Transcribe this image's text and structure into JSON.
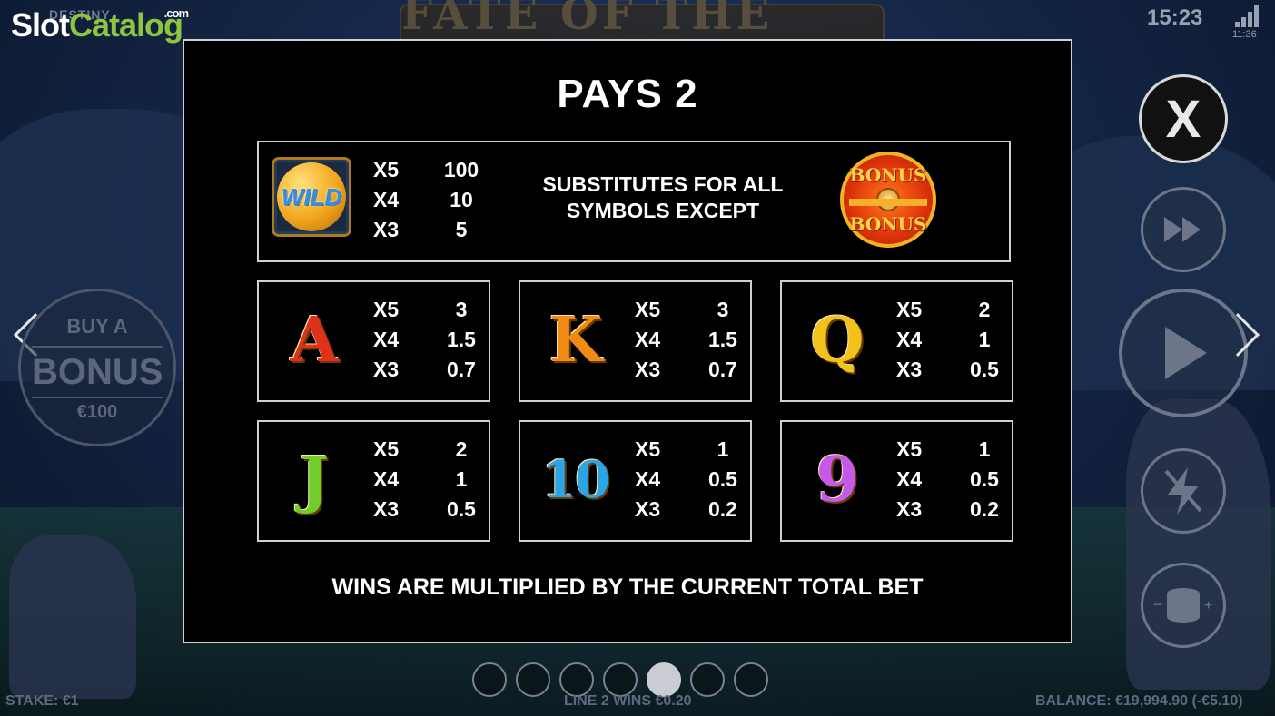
{
  "watermark": {
    "part1": "Slot",
    "part2": "Catalog",
    "suffix": ".com"
  },
  "brand_small": "DESTINY",
  "game_logo": "FATE OF THE GODS",
  "clock": {
    "time": "15:23",
    "small": "11:36"
  },
  "panel": {
    "title": "PAYS 2",
    "wild": {
      "icon_label": "WILD",
      "pays": [
        {
          "mult": "X5",
          "value": "100"
        },
        {
          "mult": "X4",
          "value": "10"
        },
        {
          "mult": "X3",
          "value": "5"
        }
      ],
      "substitute_text_line1": "SUBSTITUTES FOR ALL",
      "substitute_text_line2": "SYMBOLS EXCEPT",
      "bonus_label_top": "BONUS",
      "bonus_label_bottom": "BONUS"
    },
    "symbols": [
      {
        "glyph": "A",
        "color": "#e0321a",
        "pays": [
          {
            "mult": "X5",
            "value": "3"
          },
          {
            "mult": "X4",
            "value": "1.5"
          },
          {
            "mult": "X3",
            "value": "0.7"
          }
        ]
      },
      {
        "glyph": "K",
        "color": "#f08a12",
        "pays": [
          {
            "mult": "X5",
            "value": "3"
          },
          {
            "mult": "X4",
            "value": "1.5"
          },
          {
            "mult": "X3",
            "value": "0.7"
          }
        ]
      },
      {
        "glyph": "Q",
        "color": "#f2c21c",
        "pays": [
          {
            "mult": "X5",
            "value": "2"
          },
          {
            "mult": "X4",
            "value": "1"
          },
          {
            "mult": "X3",
            "value": "0.5"
          }
        ]
      },
      {
        "glyph": "J",
        "color": "#6fce2a",
        "pays": [
          {
            "mult": "X5",
            "value": "2"
          },
          {
            "mult": "X4",
            "value": "1"
          },
          {
            "mult": "X3",
            "value": "0.5"
          }
        ]
      },
      {
        "glyph": "10",
        "color": "#2aa5e8",
        "pays": [
          {
            "mult": "X5",
            "value": "1"
          },
          {
            "mult": "X4",
            "value": "0.5"
          },
          {
            "mult": "X3",
            "value": "0.2"
          }
        ]
      },
      {
        "glyph": "9",
        "color": "#c65ae8",
        "pays": [
          {
            "mult": "X5",
            "value": "1"
          },
          {
            "mult": "X4",
            "value": "0.5"
          },
          {
            "mult": "X3",
            "value": "0.2"
          }
        ]
      }
    ],
    "footer": "WINS ARE MULTIPLIED BY THE CURRENT TOTAL BET"
  },
  "buttons": {
    "close_label": "X",
    "buy_bonus_line1": "BUY A",
    "buy_bonus_line2": "BONUS",
    "buy_bonus_price": "€100"
  },
  "pager": {
    "total": 7,
    "active_index": 4
  },
  "status_bar": {
    "stake": "STAKE: €1",
    "last_win": "LINE 2 WINS €0.20",
    "balance": "BALANCE: €19,994.90 (-€5.10)"
  },
  "colors": {
    "panel_bg": "#000000",
    "panel_border": "#cfcfcf",
    "watermark_green": "#8cc63f"
  }
}
